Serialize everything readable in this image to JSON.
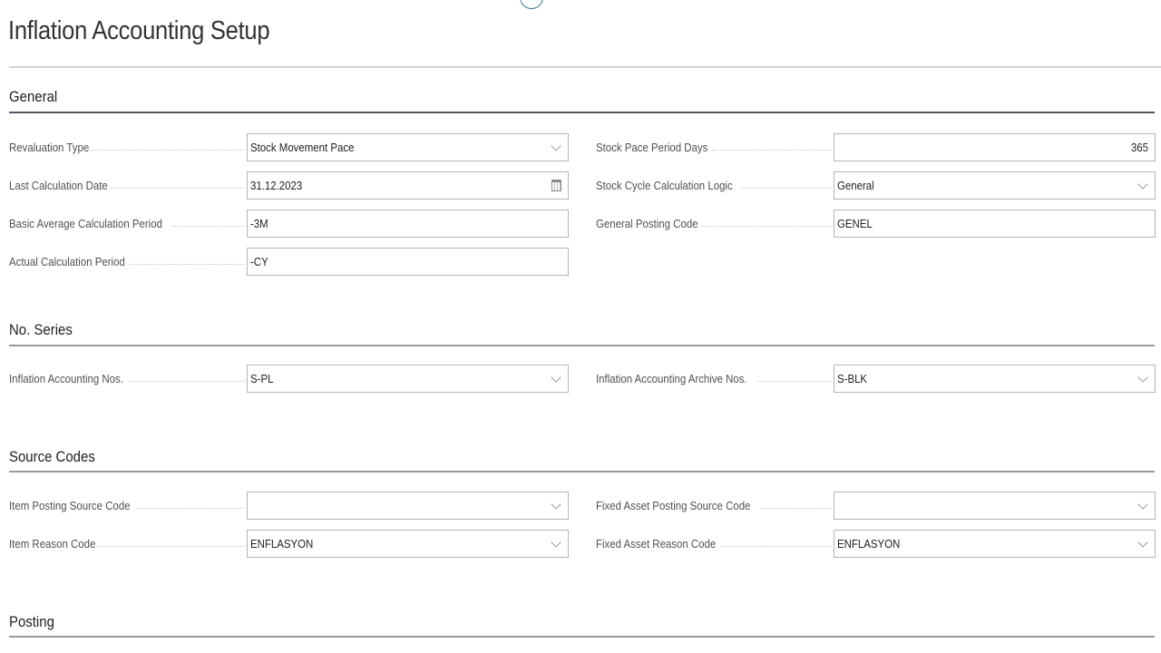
{
  "page": {
    "title": "Inflation Accounting Setup"
  },
  "sections": {
    "general": {
      "title": "General",
      "left_fields": [
        {
          "label": "Revaluation Type",
          "value": "Stock Movement Pace",
          "control": "dropdown"
        },
        {
          "label": "Last Calculation Date",
          "value": "31.12.2023",
          "control": "date"
        },
        {
          "label": "Basic Average Calculation Period",
          "value": "-3M",
          "control": "text"
        },
        {
          "label": "Actual Calculation Period",
          "value": "-CY",
          "control": "text"
        }
      ],
      "right_fields": [
        {
          "label": "Stock Pace Period Days",
          "value": "365",
          "control": "number"
        },
        {
          "label": "Stock Cycle Calculation Logic",
          "value": "General",
          "control": "dropdown"
        },
        {
          "label": "General Posting Code",
          "value": "GENEL",
          "control": "text"
        }
      ]
    },
    "no_series": {
      "title": "No. Series",
      "left_fields": [
        {
          "label": "Inflation Accounting Nos.",
          "value": "S-PL",
          "control": "dropdown"
        }
      ],
      "right_fields": [
        {
          "label": "Inflation Accounting Archive Nos.",
          "value": "S-BLK",
          "control": "dropdown"
        }
      ]
    },
    "source_codes": {
      "title": "Source Codes",
      "left_fields": [
        {
          "label": "Item Posting Source Code",
          "value": "",
          "control": "dropdown"
        },
        {
          "label": "Item Reason Code",
          "value": "ENFLASYON",
          "control": "dropdown"
        }
      ],
      "right_fields": [
        {
          "label": "Fixed Asset Posting Source Code",
          "value": "",
          "control": "dropdown"
        },
        {
          "label": "Fixed Asset Reason Code",
          "value": "ENFLASYON",
          "control": "dropdown"
        }
      ]
    },
    "posting": {
      "title": "Posting"
    }
  }
}
